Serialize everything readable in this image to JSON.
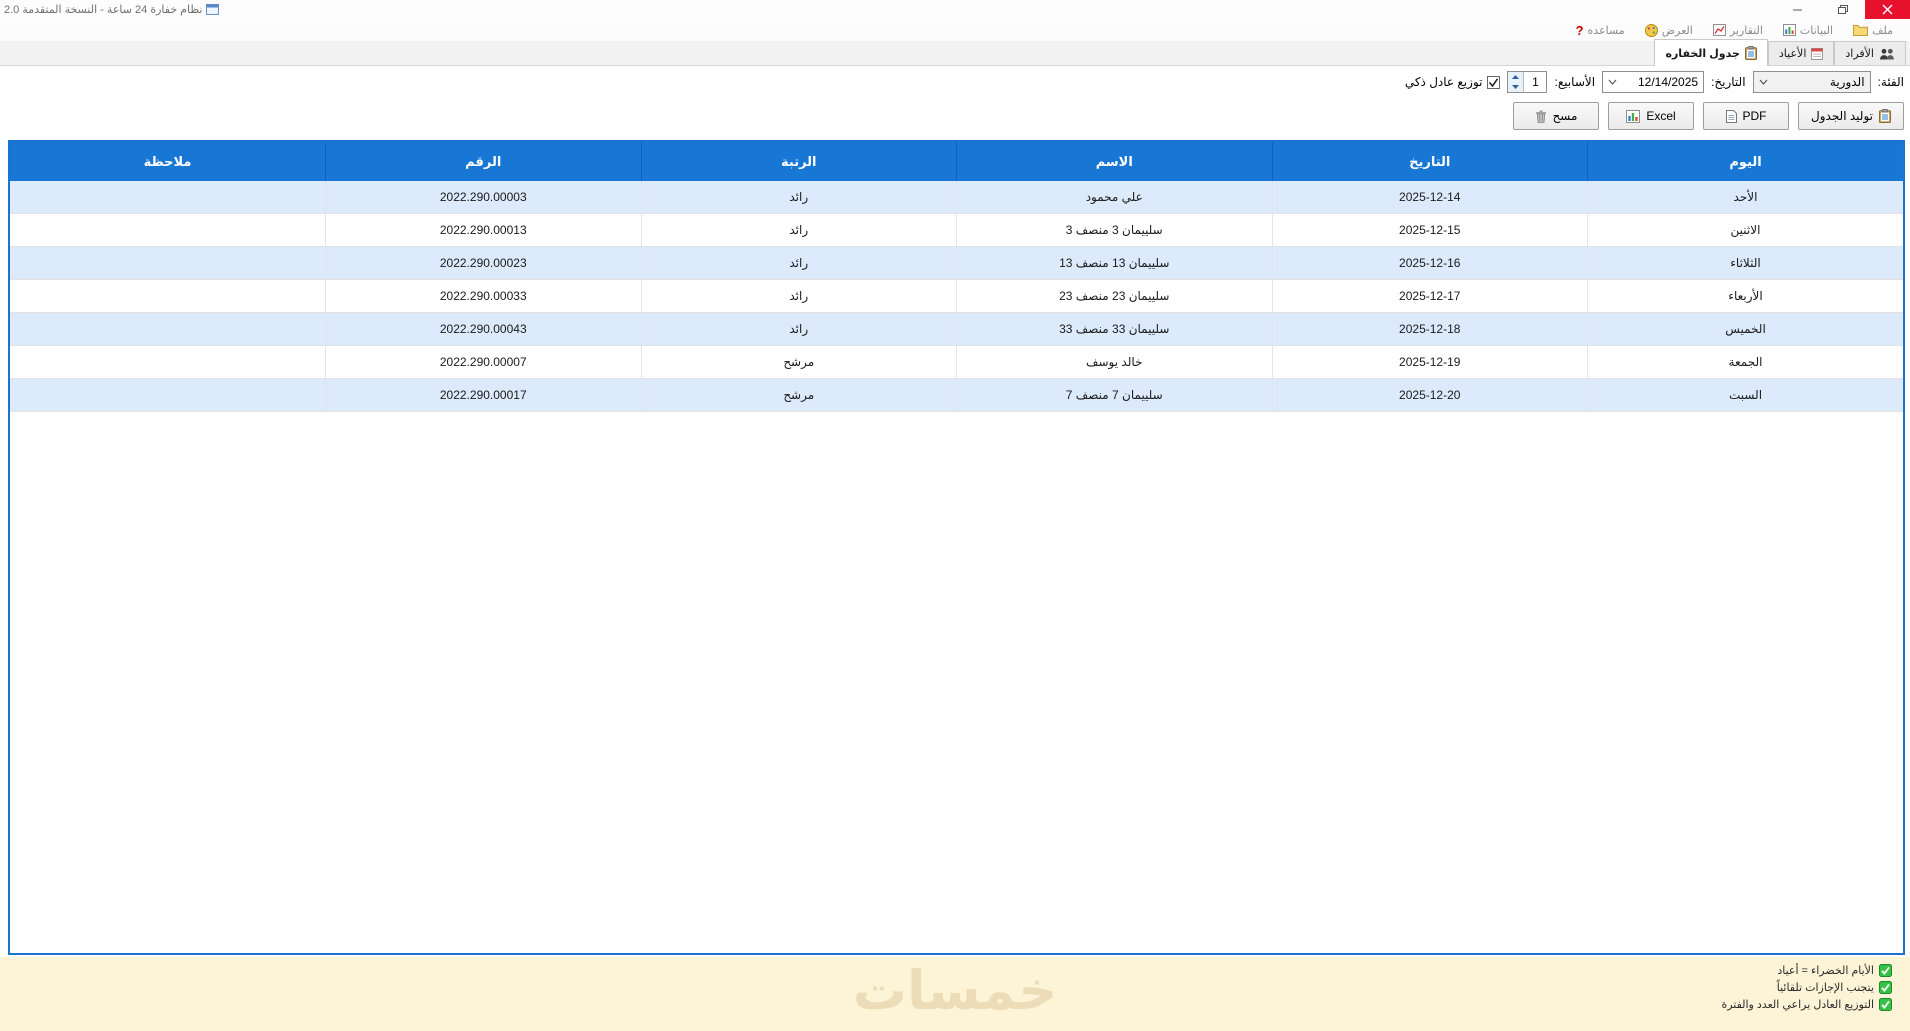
{
  "window": {
    "title": "نظام خفارة 24 ساعة - النسخة المتقدمة 2.0"
  },
  "menu": {
    "items": [
      {
        "label": "ملف",
        "icon": "folder-icon"
      },
      {
        "label": "البيانات",
        "icon": "bar-chart-icon"
      },
      {
        "label": "التقارير",
        "icon": "line-chart-icon"
      },
      {
        "label": "العرض",
        "icon": "palette-icon"
      },
      {
        "label": "مساعده",
        "icon": "help-icon"
      }
    ]
  },
  "tabs": [
    {
      "label": "الأفراد",
      "icon": "people-icon",
      "active": false
    },
    {
      "label": "الأعياد",
      "icon": "calendar-icon",
      "active": false
    },
    {
      "label": "جدول الخفاره",
      "icon": "clipboard-icon",
      "active": true
    }
  ],
  "filters": {
    "category_label": "الفئة:",
    "category_value": "الدورية",
    "date_label": "التاريخ:",
    "date_value": "12/14/2025",
    "weeks_label": "الأسابيع:",
    "weeks_value": "1",
    "smart_distribution_label": "توزيع عادل ذكي",
    "smart_distribution_checked": true
  },
  "actions": {
    "generate_label": "توليد الجدول",
    "pdf_label": "PDF",
    "excel_label": "Excel",
    "clear_label": "مسح"
  },
  "table": {
    "columns": [
      "اليوم",
      "التاريخ",
      "الاسم",
      "الرتبة",
      "الرقم",
      "ملاحظة"
    ],
    "rows": [
      {
        "day": "الأحد",
        "date": "2025-12-14",
        "name": "علي محمود",
        "rank": "رائد",
        "number": "2022.290.00003",
        "note": ""
      },
      {
        "day": "الاثنين",
        "date": "2025-12-15",
        "name": "سلييمان 3 منصف 3",
        "rank": "رائد",
        "number": "2022.290.00013",
        "note": ""
      },
      {
        "day": "الثلاثاء",
        "date": "2025-12-16",
        "name": "سلييمان 13 منصف 13",
        "rank": "رائد",
        "number": "2022.290.00023",
        "note": ""
      },
      {
        "day": "الأربعاء",
        "date": "2025-12-17",
        "name": "سلييمان 23 منصف 23",
        "rank": "رائد",
        "number": "2022.290.00033",
        "note": ""
      },
      {
        "day": "الخميس",
        "date": "2025-12-18",
        "name": "سلييمان 33 منصف 33",
        "rank": "رائد",
        "number": "2022.290.00043",
        "note": ""
      },
      {
        "day": "الجمعة",
        "date": "2025-12-19",
        "name": "خالد يوسف",
        "rank": "مرشح",
        "number": "2022.290.00007",
        "note": ""
      },
      {
        "day": "السبت",
        "date": "2025-12-20",
        "name": "سلييمان 7 منصف 7",
        "rank": "مرشح",
        "number": "2022.290.00017",
        "note": ""
      }
    ]
  },
  "footer": {
    "watermark": "خمسات",
    "notes": [
      "الأيام الخضراء = أعياد",
      "يتجنب الإجازات تلقائياً",
      "التوزيع العادل يراعي العدد والفترة"
    ]
  },
  "colors": {
    "header_blue": "#1877d4",
    "row_alt_blue": "#dceafb",
    "table_border_blue": "#1a74d0",
    "footer_cream": "#fdf3d7",
    "check_green": "#35c246",
    "close_red": "#e8112d"
  }
}
